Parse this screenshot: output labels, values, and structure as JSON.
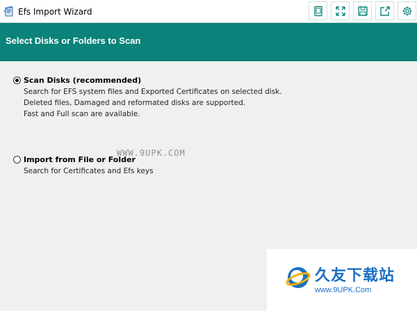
{
  "window": {
    "title": "Efs Import Wizard",
    "toolbar_icons": [
      "tablet-icon",
      "fullscreen-icon",
      "save-icon",
      "share-icon",
      "settings-icon"
    ]
  },
  "header": {
    "title": "Select Disks or Folders to Scan",
    "background": "#0b837a"
  },
  "options": [
    {
      "label": "Scan Disks (recommended)",
      "selected": true,
      "description": [
        "Search for EFS system files and Exported Certificates on selected disk.",
        "Deleted files, Damaged and reformated disks are supported.",
        "Fast  and Full scan are available."
      ]
    },
    {
      "label": "Import from File or Folder",
      "selected": false,
      "description": [
        "Search for Certificates and Efs keys"
      ]
    }
  ],
  "watermark": {
    "mid_text": "WWW.9UPK.COM",
    "brand_cn": "久友下载站",
    "brand_url": "www.9UPK.Com"
  }
}
